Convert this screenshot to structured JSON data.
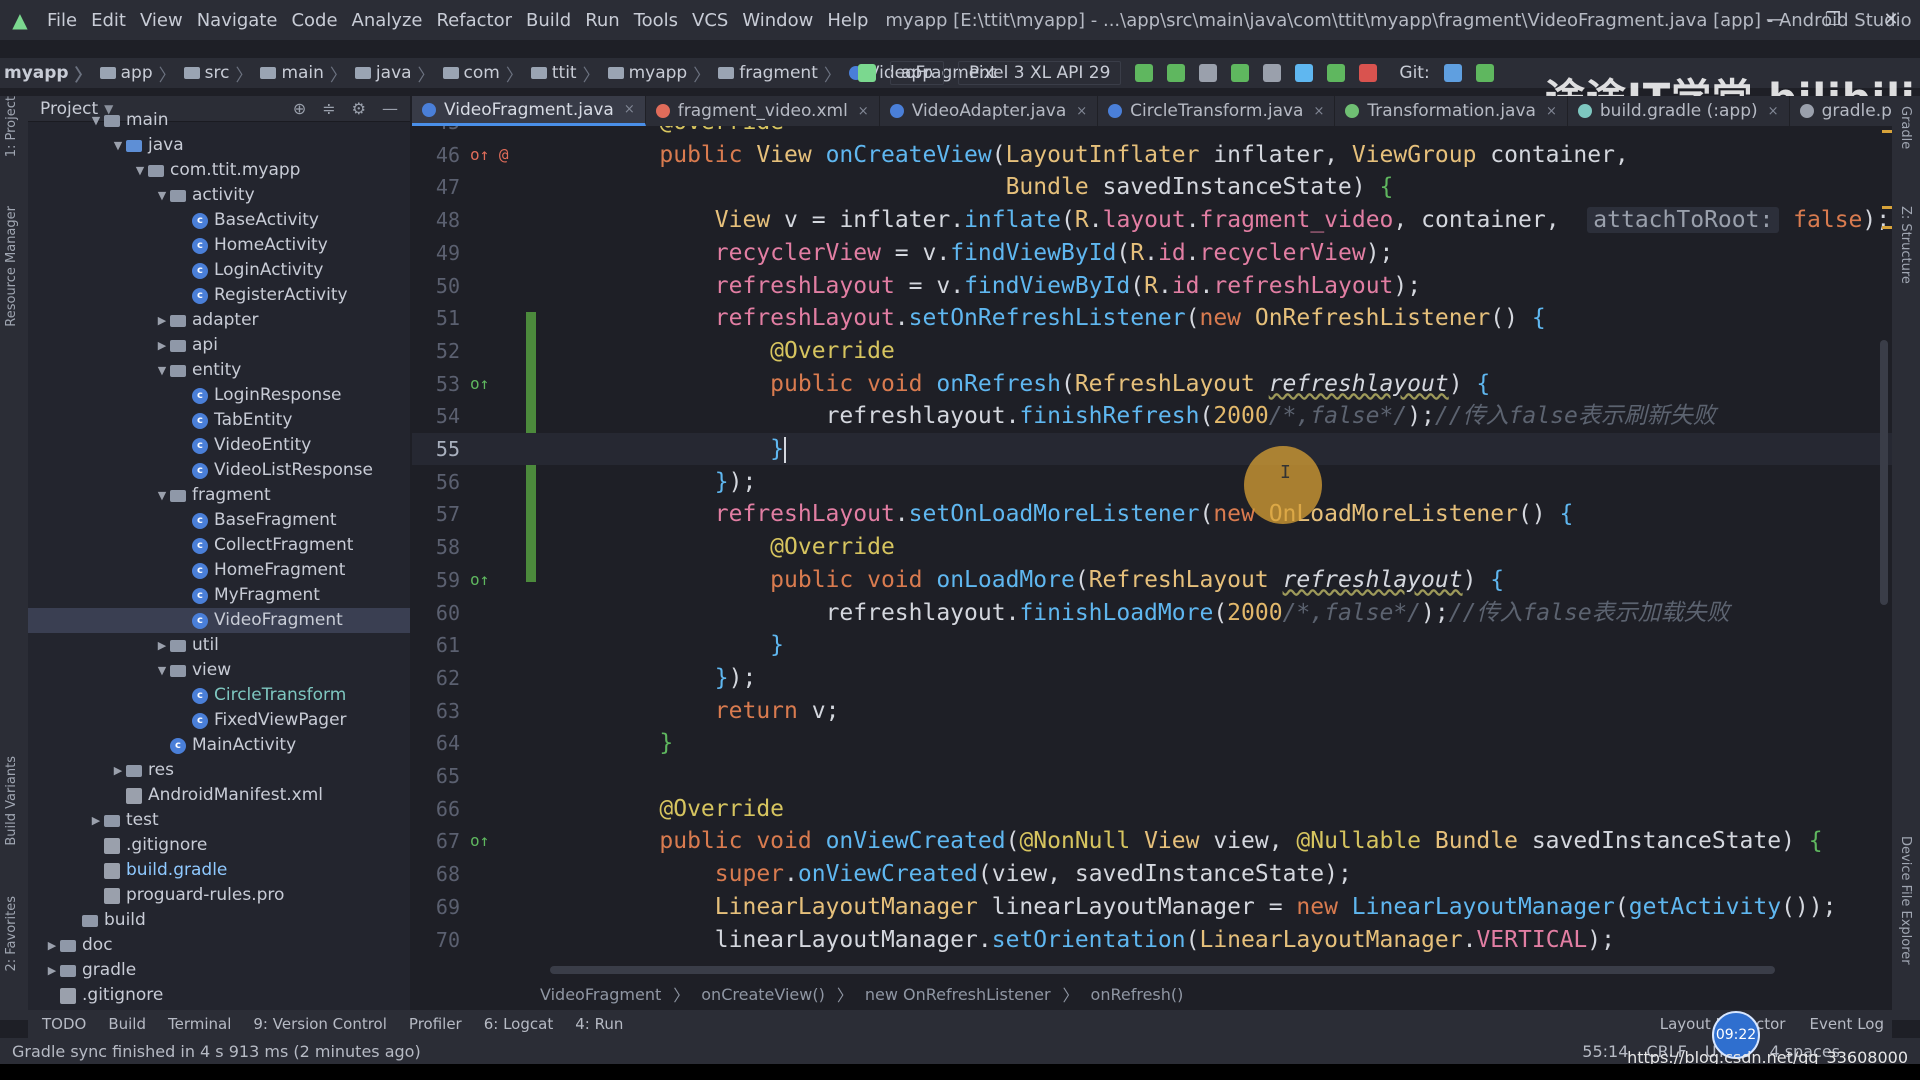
{
  "window": {
    "title": "myapp [E:\\ttit\\myapp] - ...\\app\\src\\main\\java\\com\\ttit\\myapp\\fragment\\VideoFragment.java [app] - Android Studio",
    "controls": [
      "—",
      "❐",
      "✕"
    ]
  },
  "menu": [
    "File",
    "Edit",
    "View",
    "Navigate",
    "Code",
    "Analyze",
    "Refactor",
    "Build",
    "Run",
    "Tools",
    "VCS",
    "Window",
    "Help"
  ],
  "nav": {
    "crumbs": [
      "myapp",
      "app",
      "src",
      "main",
      "java",
      "com",
      "ttit",
      "myapp",
      "fragment",
      "VideoFragment"
    ],
    "run_config": "app",
    "device": "Pixel 3 XL API 29",
    "git_label": "Git:"
  },
  "watermark": "途途IT学堂  bilibili",
  "left_tabs": [
    "1: Project",
    "Resource Manager",
    "Build Variants",
    "2: Favorites"
  ],
  "right_tabs": [
    "Gradle",
    "Z: Structure",
    "Device File Explorer"
  ],
  "project_panel": {
    "title": "Project",
    "tree": [
      {
        "label": "main",
        "type": "folder",
        "depth": 3,
        "arrow": "▼"
      },
      {
        "label": "java",
        "type": "folder-blue",
        "depth": 4,
        "arrow": "▼"
      },
      {
        "label": "com.ttit.myapp",
        "type": "folder",
        "depth": 5,
        "arrow": "▼"
      },
      {
        "label": "activity",
        "type": "folder",
        "depth": 6,
        "arrow": "▼"
      },
      {
        "label": "BaseActivity",
        "type": "class",
        "depth": 7,
        "arrow": ""
      },
      {
        "label": "HomeActivity",
        "type": "class",
        "depth": 7,
        "arrow": ""
      },
      {
        "label": "LoginActivity",
        "type": "class",
        "depth": 7,
        "arrow": ""
      },
      {
        "label": "RegisterActivity",
        "type": "class",
        "depth": 7,
        "arrow": ""
      },
      {
        "label": "adapter",
        "type": "folder",
        "depth": 6,
        "arrow": "▶"
      },
      {
        "label": "api",
        "type": "folder",
        "depth": 6,
        "arrow": "▶"
      },
      {
        "label": "entity",
        "type": "folder",
        "depth": 6,
        "arrow": "▼"
      },
      {
        "label": "LoginResponse",
        "type": "class",
        "depth": 7,
        "arrow": ""
      },
      {
        "label": "TabEntity",
        "type": "class",
        "depth": 7,
        "arrow": ""
      },
      {
        "label": "VideoEntity",
        "type": "class",
        "depth": 7,
        "arrow": ""
      },
      {
        "label": "VideoListResponse",
        "type": "class",
        "depth": 7,
        "arrow": ""
      },
      {
        "label": "fragment",
        "type": "folder",
        "depth": 6,
        "arrow": "▼"
      },
      {
        "label": "BaseFragment",
        "type": "class",
        "depth": 7,
        "arrow": ""
      },
      {
        "label": "CollectFragment",
        "type": "class",
        "depth": 7,
        "arrow": ""
      },
      {
        "label": "HomeFragment",
        "type": "class",
        "depth": 7,
        "arrow": ""
      },
      {
        "label": "MyFragment",
        "type": "class",
        "depth": 7,
        "arrow": ""
      },
      {
        "label": "VideoFragment",
        "type": "class",
        "depth": 7,
        "arrow": "",
        "selected": true
      },
      {
        "label": "util",
        "type": "folder",
        "depth": 6,
        "arrow": "▶"
      },
      {
        "label": "view",
        "type": "folder",
        "depth": 6,
        "arrow": "▼"
      },
      {
        "label": "CircleTransform",
        "type": "class",
        "depth": 7,
        "arrow": "",
        "color": "teal"
      },
      {
        "label": "FixedViewPager",
        "type": "class",
        "depth": 7,
        "arrow": ""
      },
      {
        "label": "MainActivity",
        "type": "class",
        "depth": 6,
        "arrow": ""
      },
      {
        "label": "res",
        "type": "folder",
        "depth": 4,
        "arrow": "▶"
      },
      {
        "label": "AndroidManifest.xml",
        "type": "file",
        "depth": 4,
        "arrow": ""
      },
      {
        "label": "test",
        "type": "folder",
        "depth": 3,
        "arrow": "▶"
      },
      {
        "label": ".gitignore",
        "type": "file",
        "depth": 3,
        "arrow": ""
      },
      {
        "label": "build.gradle",
        "type": "file",
        "depth": 3,
        "arrow": "",
        "color": "cyan"
      },
      {
        "label": "proguard-rules.pro",
        "type": "file",
        "depth": 3,
        "arrow": ""
      },
      {
        "label": "build",
        "type": "folder",
        "depth": 2,
        "arrow": ""
      },
      {
        "label": "doc",
        "type": "folder",
        "depth": 1,
        "arrow": "▶"
      },
      {
        "label": "gradle",
        "type": "folder",
        "depth": 1,
        "arrow": "▶"
      },
      {
        "label": ".gitignore",
        "type": "file",
        "depth": 1,
        "arrow": ""
      }
    ]
  },
  "editor_tabs": [
    {
      "label": "VideoFragment.java",
      "active": true,
      "icon_color": "#4a7fd8"
    },
    {
      "label": "fragment_video.xml",
      "active": false,
      "icon_color": "#e06c5a"
    },
    {
      "label": "VideoAdapter.java",
      "active": false,
      "icon_color": "#4a7fd8"
    },
    {
      "label": "CircleTransform.java",
      "active": false,
      "icon_color": "#4a7fd8"
    },
    {
      "label": "Transformation.java",
      "active": false,
      "icon_color": "#6fbf73"
    },
    {
      "label": "build.gradle (:app)",
      "active": false,
      "icon_color": "#7ec7c0"
    },
    {
      "label": "gradle.properties",
      "active": false,
      "icon_color": "#9aa0ac"
    }
  ],
  "code_lines": [
    {
      "n": "45",
      "tokens": [
        [
          "tk-plain",
          "    "
        ],
        [
          "tk-ann",
          "@Override"
        ]
      ]
    },
    {
      "n": "46",
      "gutter": "o↑ @",
      "tokens": [
        [
          "tk-plain",
          "    "
        ],
        [
          "tk-kw",
          "public "
        ],
        [
          "tk-type",
          "View "
        ],
        [
          "tk-fn",
          "onCreateView"
        ],
        [
          "tk-plain",
          "("
        ],
        [
          "tk-type",
          "LayoutInflater "
        ],
        [
          "tk-var",
          "inflater"
        ],
        [
          "tk-plain",
          ", "
        ],
        [
          "tk-type",
          "ViewGroup "
        ],
        [
          "tk-var",
          "container"
        ],
        [
          "tk-plain",
          ","
        ]
      ]
    },
    {
      "n": "47",
      "tokens": [
        [
          "tk-plain",
          "                             "
        ],
        [
          "tk-type",
          "Bundle "
        ],
        [
          "tk-var",
          "savedInstanceState"
        ],
        [
          "tk-plain",
          ") "
        ],
        [
          "tk-brace",
          "{"
        ]
      ]
    },
    {
      "n": "48",
      "tokens": [
        [
          "tk-plain",
          "        "
        ],
        [
          "tk-type",
          "View "
        ],
        [
          "tk-var",
          "v "
        ],
        [
          "tk-plain",
          "= "
        ],
        [
          "tk-var",
          "inflater"
        ],
        [
          "tk-plain",
          "."
        ],
        [
          "tk-fn",
          "inflate"
        ],
        [
          "tk-plain",
          "("
        ],
        [
          "tk-type",
          "R"
        ],
        [
          "tk-plain",
          "."
        ],
        [
          "tk-field",
          "layout"
        ],
        [
          "tk-plain",
          "."
        ],
        [
          "tk-field",
          "fragment_video"
        ],
        [
          "tk-plain",
          ", "
        ],
        [
          "tk-var",
          "container"
        ],
        [
          "tk-plain",
          ",  "
        ],
        [
          "hint",
          "attachToRoot:"
        ],
        [
          "tk-kw",
          " false"
        ],
        [
          "tk-plain",
          ");"
        ]
      ]
    },
    {
      "n": "49",
      "tokens": [
        [
          "tk-plain",
          "        "
        ],
        [
          "tk-field",
          "recyclerView "
        ],
        [
          "tk-plain",
          "= "
        ],
        [
          "tk-var",
          "v"
        ],
        [
          "tk-plain",
          "."
        ],
        [
          "tk-fn",
          "findViewById"
        ],
        [
          "tk-plain",
          "("
        ],
        [
          "tk-type",
          "R"
        ],
        [
          "tk-plain",
          "."
        ],
        [
          "tk-field",
          "id"
        ],
        [
          "tk-plain",
          "."
        ],
        [
          "tk-field",
          "recyclerView"
        ],
        [
          "tk-plain",
          ");"
        ]
      ]
    },
    {
      "n": "50",
      "tokens": [
        [
          "tk-plain",
          "        "
        ],
        [
          "tk-field",
          "refreshLayout "
        ],
        [
          "tk-plain",
          "= "
        ],
        [
          "tk-var",
          "v"
        ],
        [
          "tk-plain",
          "."
        ],
        [
          "tk-fn",
          "findViewById"
        ],
        [
          "tk-plain",
          "("
        ],
        [
          "tk-type",
          "R"
        ],
        [
          "tk-plain",
          "."
        ],
        [
          "tk-field",
          "id"
        ],
        [
          "tk-plain",
          "."
        ],
        [
          "tk-field",
          "refreshLayout"
        ],
        [
          "tk-plain",
          ");"
        ]
      ]
    },
    {
      "n": "51",
      "tokens": [
        [
          "tk-plain",
          "        "
        ],
        [
          "tk-field",
          "refreshLayout"
        ],
        [
          "tk-plain",
          "."
        ],
        [
          "tk-fn",
          "setOnRefreshListener"
        ],
        [
          "tk-plain",
          "("
        ],
        [
          "tk-kw",
          "new "
        ],
        [
          "tk-type",
          "OnRefreshListener"
        ],
        [
          "tk-plain",
          "() "
        ],
        [
          "tk-fn",
          "{"
        ]
      ]
    },
    {
      "n": "52",
      "tokens": [
        [
          "tk-plain",
          "            "
        ],
        [
          "tk-ann",
          "@Override"
        ]
      ]
    },
    {
      "n": "53",
      "gutter": "o↑",
      "tokens": [
        [
          "tk-plain",
          "            "
        ],
        [
          "tk-kw",
          "public void "
        ],
        [
          "tk-fn",
          "onRefresh"
        ],
        [
          "tk-plain",
          "("
        ],
        [
          "tk-type",
          "RefreshLayout "
        ],
        [
          "tk-param",
          "refreshlayout"
        ],
        [
          "tk-plain",
          ") "
        ],
        [
          "tk-fn",
          "{"
        ]
      ]
    },
    {
      "n": "54",
      "tokens": [
        [
          "tk-plain",
          "                "
        ],
        [
          "tk-var",
          "refreshlayout"
        ],
        [
          "tk-plain",
          "."
        ],
        [
          "tk-fn",
          "finishRefresh"
        ],
        [
          "tk-plain",
          "("
        ],
        [
          "tk-num",
          "2000"
        ],
        [
          "tk-cmt",
          "/*,false*/"
        ],
        [
          "tk-plain",
          ");"
        ],
        [
          "tk-cmt",
          "//传入false表示刷新失败"
        ]
      ]
    },
    {
      "n": "55",
      "current": true,
      "tokens": [
        [
          "tk-plain",
          "            "
        ],
        [
          "tk-fn",
          "}"
        ],
        [
          "caret",
          ""
        ]
      ]
    },
    {
      "n": "56",
      "tokens": [
        [
          "tk-plain",
          "        "
        ],
        [
          "tk-fn",
          "}"
        ],
        [
          "tk-plain",
          ");"
        ]
      ]
    },
    {
      "n": "57",
      "tokens": [
        [
          "tk-plain",
          "        "
        ],
        [
          "tk-field",
          "refreshLayout"
        ],
        [
          "tk-plain",
          "."
        ],
        [
          "tk-fn",
          "setOnLoadMoreListener"
        ],
        [
          "tk-plain",
          "("
        ],
        [
          "tk-kw",
          "new "
        ],
        [
          "tk-type",
          "OnLoadMoreListener"
        ],
        [
          "tk-plain",
          "() "
        ],
        [
          "tk-fn",
          "{"
        ]
      ]
    },
    {
      "n": "58",
      "tokens": [
        [
          "tk-plain",
          "            "
        ],
        [
          "tk-ann",
          "@Override"
        ]
      ]
    },
    {
      "n": "59",
      "gutter": "o↑",
      "tokens": [
        [
          "tk-plain",
          "            "
        ],
        [
          "tk-kw",
          "public void "
        ],
        [
          "tk-fn",
          "onLoadMore"
        ],
        [
          "tk-plain",
          "("
        ],
        [
          "tk-type",
          "RefreshLayout "
        ],
        [
          "tk-param",
          "refreshlayout"
        ],
        [
          "tk-plain",
          ") "
        ],
        [
          "tk-fn",
          "{"
        ]
      ]
    },
    {
      "n": "60",
      "tokens": [
        [
          "tk-plain",
          "                "
        ],
        [
          "tk-var",
          "refreshlayout"
        ],
        [
          "tk-plain",
          "."
        ],
        [
          "tk-fn",
          "finishLoadMore"
        ],
        [
          "tk-plain",
          "("
        ],
        [
          "tk-num",
          "2000"
        ],
        [
          "tk-cmt",
          "/*,false*/"
        ],
        [
          "tk-plain",
          ");"
        ],
        [
          "tk-cmt",
          "//传入false表示加载失败"
        ]
      ]
    },
    {
      "n": "61",
      "tokens": [
        [
          "tk-plain",
          "            "
        ],
        [
          "tk-fn",
          "}"
        ]
      ]
    },
    {
      "n": "62",
      "tokens": [
        [
          "tk-plain",
          "        "
        ],
        [
          "tk-fn",
          "}"
        ],
        [
          "tk-plain",
          ");"
        ]
      ]
    },
    {
      "n": "63",
      "tokens": [
        [
          "tk-plain",
          "        "
        ],
        [
          "tk-kw",
          "return "
        ],
        [
          "tk-var",
          "v"
        ],
        [
          "tk-plain",
          ";"
        ]
      ]
    },
    {
      "n": "64",
      "tokens": [
        [
          "tk-plain",
          "    "
        ],
        [
          "tk-brace",
          "}"
        ]
      ]
    },
    {
      "n": "65",
      "tokens": []
    },
    {
      "n": "66",
      "tokens": [
        [
          "tk-plain",
          "    "
        ],
        [
          "tk-ann",
          "@Override"
        ]
      ]
    },
    {
      "n": "67",
      "gutter": "o↑",
      "tokens": [
        [
          "tk-plain",
          "    "
        ],
        [
          "tk-kw",
          "public void "
        ],
        [
          "tk-fn",
          "onViewCreated"
        ],
        [
          "tk-plain",
          "("
        ],
        [
          "tk-ann",
          "@NonNull "
        ],
        [
          "tk-type",
          "View "
        ],
        [
          "tk-var",
          "view"
        ],
        [
          "tk-plain",
          ", "
        ],
        [
          "tk-ann",
          "@Nullable "
        ],
        [
          "tk-type",
          "Bundle "
        ],
        [
          "tk-var",
          "savedInstanceState"
        ],
        [
          "tk-plain",
          ") "
        ],
        [
          "tk-brace",
          "{"
        ]
      ]
    },
    {
      "n": "68",
      "tokens": [
        [
          "tk-plain",
          "        "
        ],
        [
          "tk-kw",
          "super"
        ],
        [
          "tk-plain",
          "."
        ],
        [
          "tk-fn",
          "onViewCreated"
        ],
        [
          "tk-plain",
          "("
        ],
        [
          "tk-var",
          "view"
        ],
        [
          "tk-plain",
          ", "
        ],
        [
          "tk-var",
          "savedInstanceState"
        ],
        [
          "tk-plain",
          ");"
        ]
      ]
    },
    {
      "n": "69",
      "tokens": [
        [
          "tk-plain",
          "        "
        ],
        [
          "tk-type",
          "LinearLayoutManager "
        ],
        [
          "tk-var",
          "linearLayoutManager "
        ],
        [
          "tk-plain",
          "= "
        ],
        [
          "tk-kw",
          "new "
        ],
        [
          "tk-fn",
          "LinearLayoutManager"
        ],
        [
          "tk-plain",
          "("
        ],
        [
          "tk-fn",
          "getActivity"
        ],
        [
          "tk-plain",
          "());"
        ]
      ]
    },
    {
      "n": "70",
      "tokens": [
        [
          "tk-plain",
          "        "
        ],
        [
          "tk-var",
          "linearLayoutManager"
        ],
        [
          "tk-plain",
          "."
        ],
        [
          "tk-fn",
          "setOrientation"
        ],
        [
          "tk-plain",
          "("
        ],
        [
          "tk-type",
          "LinearLayoutManager"
        ],
        [
          "tk-plain",
          "."
        ],
        [
          "tk-field",
          "VERTICAL"
        ],
        [
          "tk-plain",
          ");"
        ]
      ]
    }
  ],
  "breadcrumbs": [
    "VideoFragment",
    "onCreateView()",
    "new OnRefreshListener",
    "onRefresh()"
  ],
  "tool_windows": [
    "TODO",
    "Build",
    "Terminal",
    "9: Version Control",
    "Profiler",
    "6: Logcat",
    "4: Run"
  ],
  "tool_windows_right": [
    "Layout Inspector",
    "Event Log"
  ],
  "status": {
    "message": "Gradle sync finished in 4 s 913 ms (2 minutes ago)",
    "position": "55:14",
    "line_sep": "CRLF",
    "encoding": "UTF-8",
    "indent": "4 spaces"
  },
  "clock": "09:22",
  "url_watermark": "https://blog.csdn.net/qq_33608000"
}
